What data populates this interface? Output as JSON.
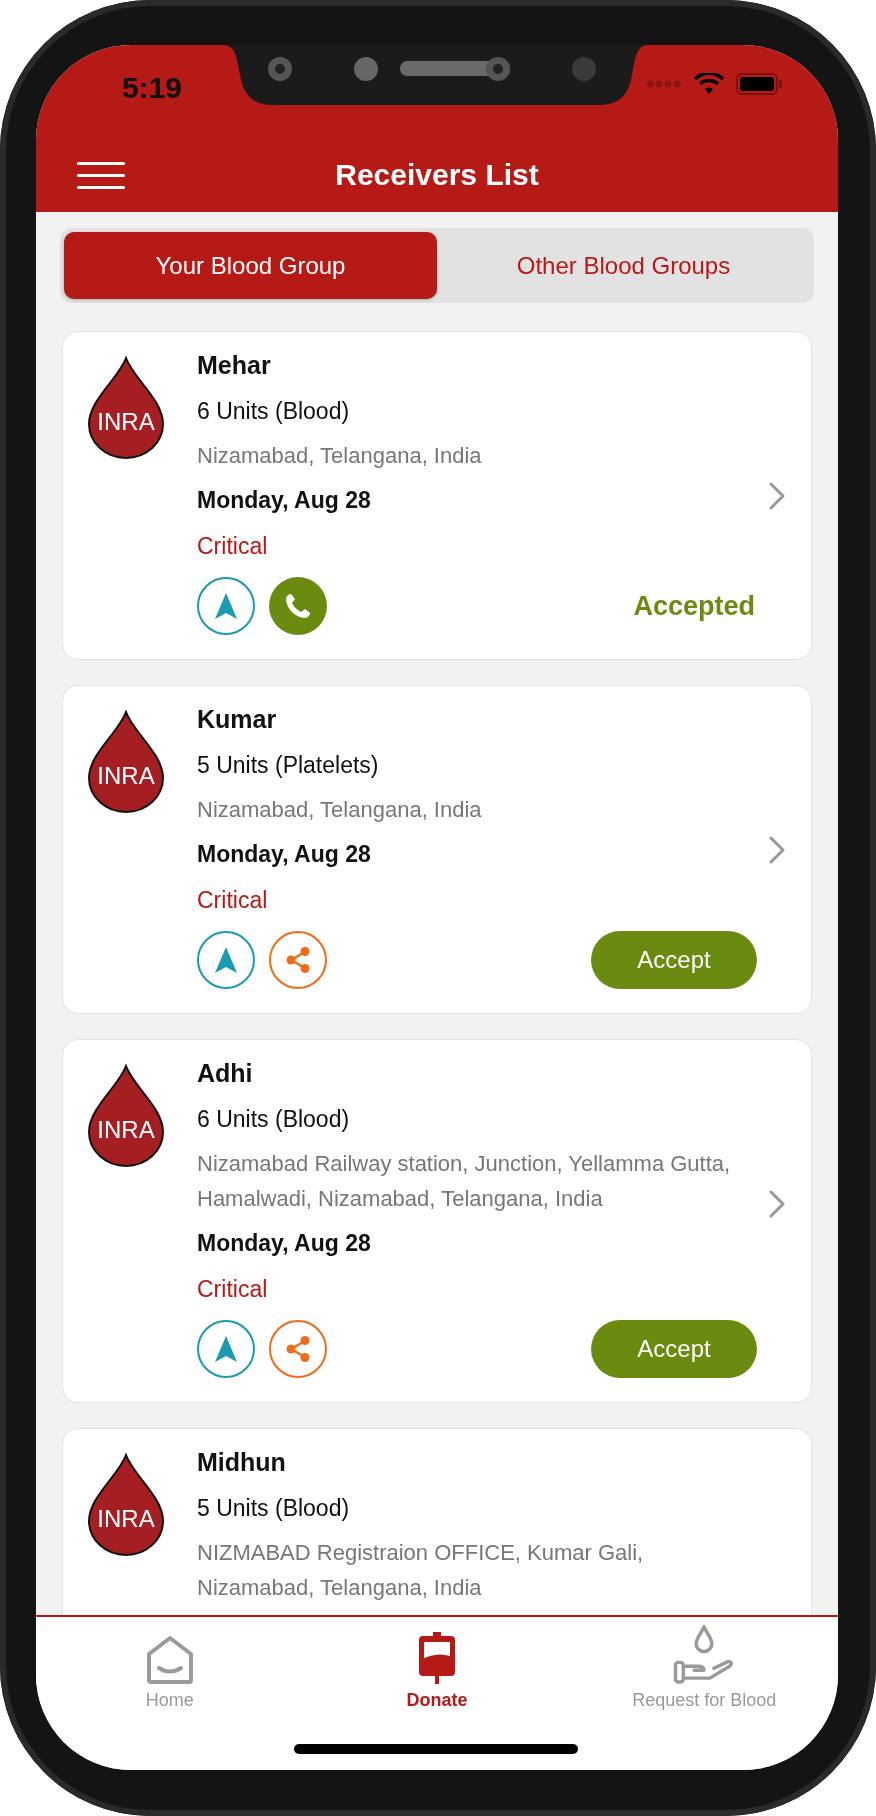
{
  "status_bar": {
    "time": "5:19"
  },
  "header": {
    "title": "Receivers List"
  },
  "tabs": [
    {
      "label": "Your Blood Group",
      "selected": true
    },
    {
      "label": "Other Blood Groups",
      "selected": false
    }
  ],
  "receivers": [
    {
      "badge": "INRA",
      "name": "Mehar",
      "units": "6 Units (Blood)",
      "address": "Nizamabad, Telangana, India",
      "date": "Monday, Aug 28",
      "urgency": "Critical",
      "actions": [
        {
          "kind": "navigate"
        },
        {
          "kind": "call"
        }
      ],
      "status": {
        "kind": "label",
        "text": "Accepted"
      }
    },
    {
      "badge": "INRA",
      "name": "Kumar",
      "units": "5 Units (Platelets)",
      "address": "Nizamabad, Telangana, India",
      "date": "Monday, Aug 28",
      "urgency": "Critical",
      "actions": [
        {
          "kind": "navigate"
        },
        {
          "kind": "share"
        }
      ],
      "status": {
        "kind": "button",
        "text": "Accept"
      }
    },
    {
      "badge": "INRA",
      "name": "Adhi",
      "units": "6 Units (Blood)",
      "address": "Nizamabad Railway station, Junction, Yellamma Gutta, Hamalwadi, Nizamabad, Telangana, India",
      "date": "Monday, Aug 28",
      "urgency": "Critical",
      "actions": [
        {
          "kind": "navigate"
        },
        {
          "kind": "share"
        }
      ],
      "status": {
        "kind": "button",
        "text": "Accept"
      }
    },
    {
      "badge": "INRA",
      "name": "Midhun",
      "units": "5 Units (Blood)",
      "address": "NIZMABAD Registraion OFFICE, Kumar Gali, Nizamabad, Telangana, India"
    }
  ],
  "bottom_nav": [
    {
      "kind": "home",
      "label": "Home",
      "selected": false
    },
    {
      "kind": "donate",
      "label": "Donate",
      "selected": true
    },
    {
      "kind": "request",
      "label": "Request for Blood",
      "selected": false
    }
  ]
}
